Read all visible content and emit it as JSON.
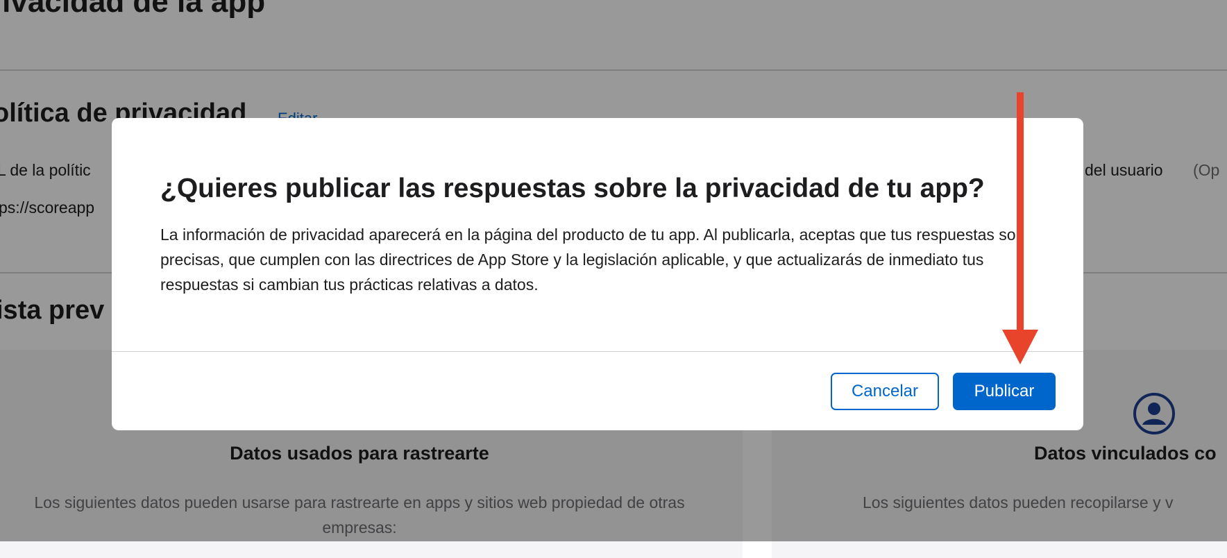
{
  "page": {
    "title": "rivacidad de la app",
    "policy_section": {
      "title": "olítica de privacidad",
      "edit_label": "Editar",
      "url_label": "L de la polític",
      "url_value": "ps://scoreapp",
      "user_field_label": "del usuario",
      "user_field_optional": "(Op"
    },
    "preview_section": {
      "title": "ista prev"
    },
    "cards": [
      {
        "title": "Datos usados para rastrearte",
        "text": "Los siguientes datos pueden usarse para rastrearte en apps y sitios web propiedad de otras empresas:"
      },
      {
        "title": "Datos vinculados co",
        "text": "Los siguientes datos pueden recopilarse y v",
        "icon": "user-circle-icon"
      }
    ]
  },
  "dialog": {
    "title": "¿Quieres publicar las respuestas sobre la privacidad de tu app?",
    "body": "La información de privacidad aparecerá en la página del producto de tu app. Al publicarla, aceptas que tus respuestas son precisas, que cumplen con las directrices de App Store y la legislación aplicable, y que actualizarás de inmediato tus respuestas si cambian tus prácticas relativas a datos.",
    "cancel_label": "Cancelar",
    "publish_label": "Publicar"
  },
  "annotation": {
    "icon": "down-arrow-icon",
    "color": "#e8442b"
  },
  "colors": {
    "accent": "#0066cc",
    "overlay": "rgba(0,0,0,0.40)"
  }
}
